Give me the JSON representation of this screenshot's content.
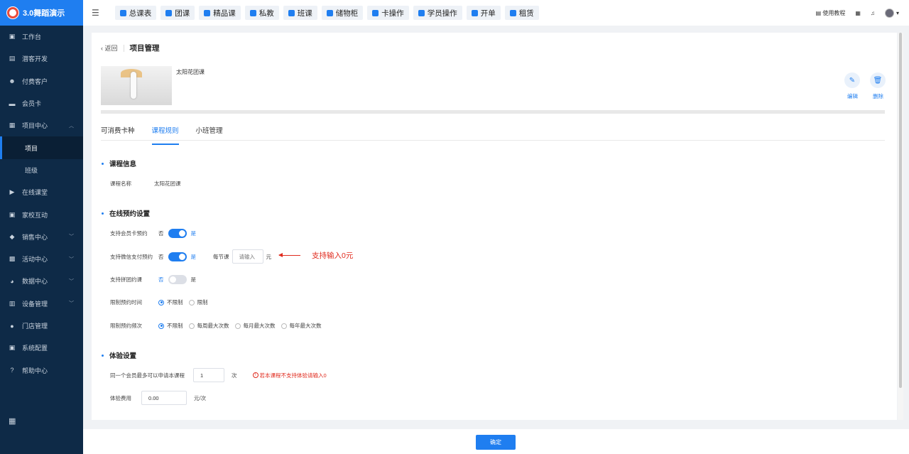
{
  "app": {
    "title": "3.0舞蹈演示"
  },
  "sidebar": {
    "items": [
      {
        "label": "工作台",
        "icon": "dashboard-icon"
      },
      {
        "label": "潜客开发",
        "icon": "id-card-icon"
      },
      {
        "label": "付费客户",
        "icon": "users-icon"
      },
      {
        "label": "会员卡",
        "icon": "card-icon"
      },
      {
        "label": "项目中心",
        "icon": "folder-icon",
        "expanded": true
      },
      {
        "label": "项目",
        "sub": true,
        "active": true
      },
      {
        "label": "班级",
        "sub": true
      },
      {
        "label": "在线课堂",
        "icon": "video-icon"
      },
      {
        "label": "家校互动",
        "icon": "contact-icon"
      },
      {
        "label": "销售中心",
        "icon": "tag-icon"
      },
      {
        "label": "活动中心",
        "icon": "gift-icon"
      },
      {
        "label": "数据中心",
        "icon": "pie-chart-icon"
      },
      {
        "label": "设备管理",
        "icon": "device-icon"
      },
      {
        "label": "门店管理",
        "icon": "store-icon"
      },
      {
        "label": "系统配置",
        "icon": "monitor-icon"
      },
      {
        "label": "帮助中心",
        "icon": "help-icon"
      }
    ]
  },
  "topnav": [
    "总课表",
    "团课",
    "精品课",
    "私教",
    "班课",
    "储物柜",
    "卡操作",
    "学员操作",
    "开单",
    "租赁"
  ],
  "topright": {
    "help_label": "使用教程"
  },
  "header": {
    "back_label": "返回",
    "title": "项目管理"
  },
  "course": {
    "name": "太阳花团课",
    "edit_label": "编辑",
    "delete_label": "删除"
  },
  "tabs": [
    "可消费卡种",
    "课程规则",
    "小班管理"
  ],
  "section_course_info": {
    "title": "课程信息",
    "name_label": "课程名称",
    "name_value": "太阳花团课"
  },
  "section_booking": {
    "title": "在线预约设置",
    "member_card_label": "支持会员卡预约",
    "wechat_pay_label": "支持微信支付预约",
    "group_label": "支持拼团约课",
    "no_label": "否",
    "yes_label": "是",
    "member_card_on": true,
    "wechat_pay_on": true,
    "group_on": false,
    "per_class_label": "每节课",
    "price_placeholder": "请输入",
    "unit_yuan": "元",
    "annotation": "支持输入0元",
    "limit_time_label": "限制预约时间",
    "limit_time_options": [
      "不限制",
      "限制"
    ],
    "limit_freq_label": "限制预约频次",
    "limit_freq_options": [
      "不限制",
      "每周最大次数",
      "每月最大次数",
      "每年最大次数"
    ]
  },
  "section_trial": {
    "title": "体验设置",
    "max_label": "同一个会员最多可以申请本课程",
    "max_value": "1",
    "max_unit": "次",
    "warning": "若本课程不支持体验请输入0",
    "fee_label": "体验费用",
    "fee_value": "0.00",
    "fee_unit": "元/次"
  },
  "footer": {
    "confirm_label": "确定"
  }
}
